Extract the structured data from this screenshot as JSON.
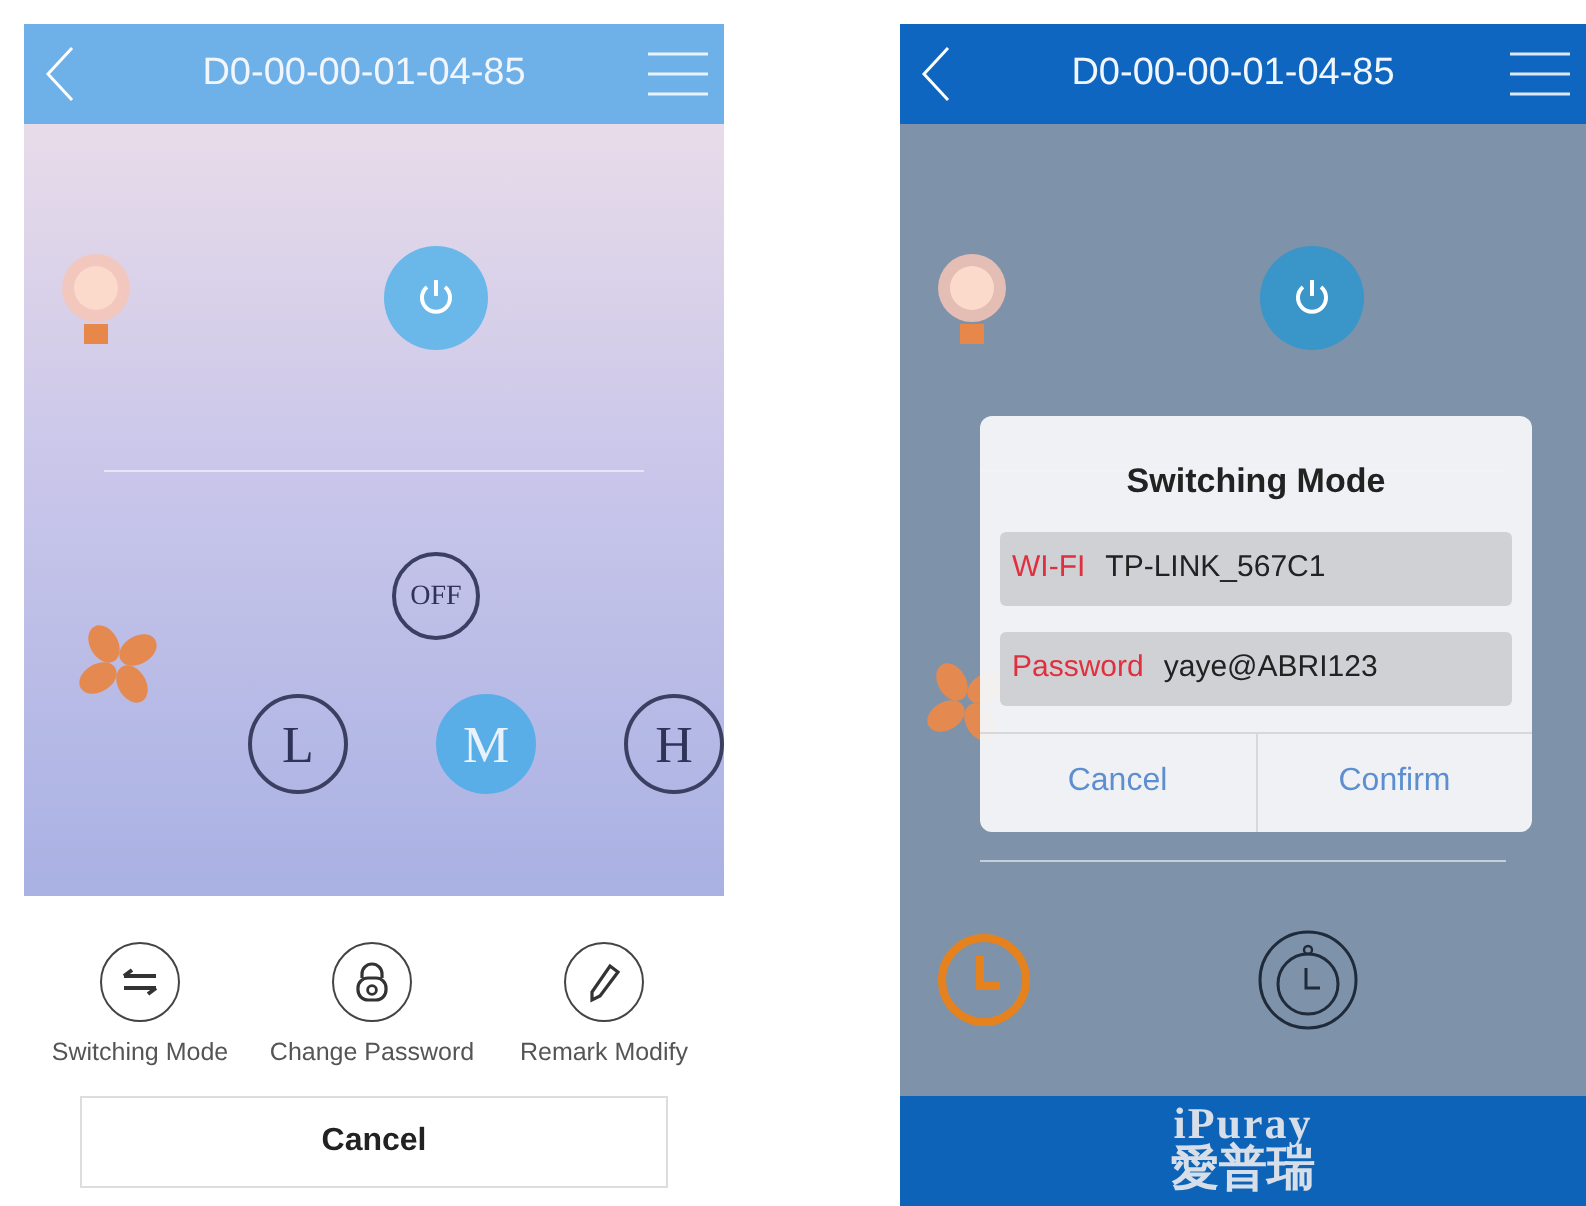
{
  "screens": [
    {
      "header": {
        "title": "D0-00-00-01-04-85"
      },
      "power": {
        "on": true
      },
      "fan_speeds": [
        {
          "label": "OFF",
          "selected": false
        },
        {
          "label": "L",
          "selected": false
        },
        {
          "label": "M",
          "selected": true
        },
        {
          "label": "H",
          "selected": false
        }
      ],
      "action_sheet": {
        "actions": [
          {
            "label": "Switching Mode",
            "kind": "switch"
          },
          {
            "label": "Change Password",
            "kind": "lock"
          },
          {
            "label": "Remark Modify",
            "kind": "pencil"
          }
        ],
        "cancel": "Cancel"
      }
    },
    {
      "header": {
        "title": "D0-00-00-01-04-85"
      },
      "power": {
        "on": true
      },
      "dialog": {
        "title": "Switching Mode",
        "fields": [
          {
            "label": "WI-FI",
            "value": "TP-LINK_567C1"
          },
          {
            "label": "Password",
            "value": "yaye@ABRI123"
          }
        ],
        "buttons": [
          "Cancel",
          "Confirm"
        ]
      },
      "footer": {
        "logo_latin": "iPuray",
        "logo_cjk": "愛普瑞"
      }
    }
  ]
}
